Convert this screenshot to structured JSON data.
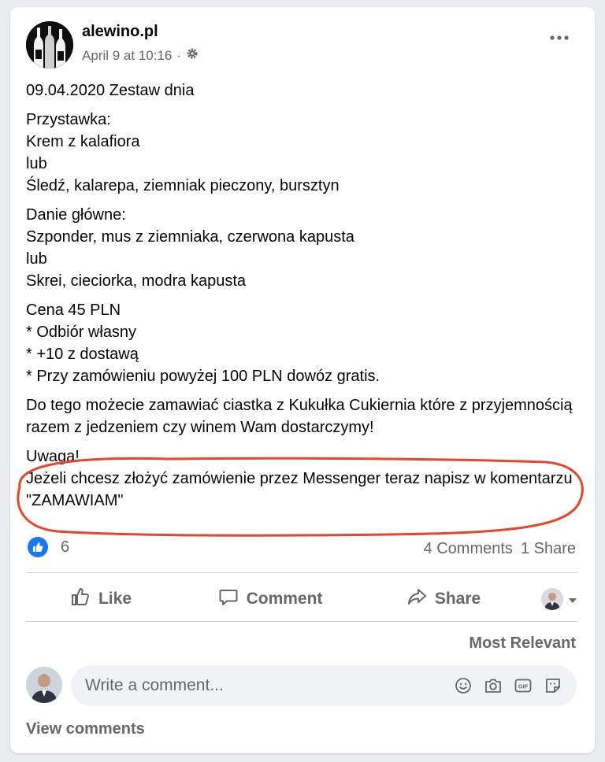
{
  "post": {
    "page_name": "alewino.pl",
    "timestamp": "April 9 at 10:16",
    "paragraphs": [
      "09.04.2020 Zestaw dnia",
      "Przystawka:\nKrem z kalafiora\nlub\nŚledź, kalarepa, ziemniak pieczony, bursztyn",
      "Danie główne:\nSzponder, mus z ziemniaka, czerwona kapusta\nlub\nSkrei, cieciorka, modra kapusta",
      "Cena 45 PLN\n* Odbiór własny\n* +10 z dostawą\n* Przy zamówieniu powyżej 100 PLN dowóz gratis.",
      "Do tego możecie zamawiać ciastka z Kukułka Cukiernia które z przyjemnością razem z jedzeniem czy winem Wam dostarczymy!",
      "Uwaga!\nJeżeli chcesz złożyć zamówienie przez Messenger teraz napisz w komentarzu \"ZAMAWIAM\""
    ]
  },
  "stats": {
    "reaction_count": "6",
    "comments": "4 Comments",
    "shares": "1 Share"
  },
  "actions": {
    "like": "Like",
    "comment": "Comment",
    "share": "Share"
  },
  "comments": {
    "sort_label": "Most Relevant",
    "placeholder": "Write a comment...",
    "view_comments": "View comments"
  },
  "colors": {
    "accent": "#1877f2",
    "highlight": "#e8452c"
  },
  "icons": [
    "gear-icon",
    "more-icon",
    "like-reaction-icon",
    "thumbs-up-icon",
    "comment-bubble-icon",
    "share-arrow-icon",
    "chevron-down-icon",
    "emoji-icon",
    "camera-icon",
    "gif-icon",
    "sticker-icon"
  ]
}
